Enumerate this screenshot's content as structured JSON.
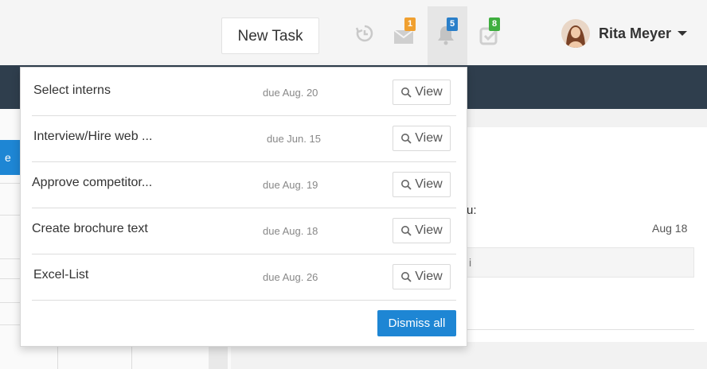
{
  "header": {
    "new_task_label": "New Task",
    "icons": [
      {
        "name": "history-icon"
      },
      {
        "name": "messages-icon",
        "badge": "1",
        "badge_color": "#f0a030"
      },
      {
        "name": "bell-icon",
        "badge": "5",
        "badge_color": "#2a7fc9"
      },
      {
        "name": "tasks-check-icon",
        "badge": "8",
        "badge_color": "#3fae3f"
      }
    ],
    "user_name": "Rita Meyer"
  },
  "background": {
    "partial_label": "u:",
    "partial_date": "Aug 18",
    "input_partial": "i",
    "blue_tab_char": "e"
  },
  "dropdown": {
    "items": [
      {
        "title": "Select interns",
        "due": "due Aug. 20",
        "action": "View"
      },
      {
        "title": "Interview/Hire web ...",
        "due": "due Jun. 15",
        "action": "View"
      },
      {
        "title": "Approve competitor...",
        "due": "due Aug. 19",
        "action": "View"
      },
      {
        "title": "Create brochure text",
        "due": "due Aug. 18",
        "action": "View"
      },
      {
        "title": "Excel-List",
        "due": "due Aug. 26",
        "action": "View"
      }
    ],
    "dismiss_label": "Dismiss all"
  },
  "colors": {
    "accent": "#1e86d4",
    "dark_band": "#2f3e4d"
  }
}
